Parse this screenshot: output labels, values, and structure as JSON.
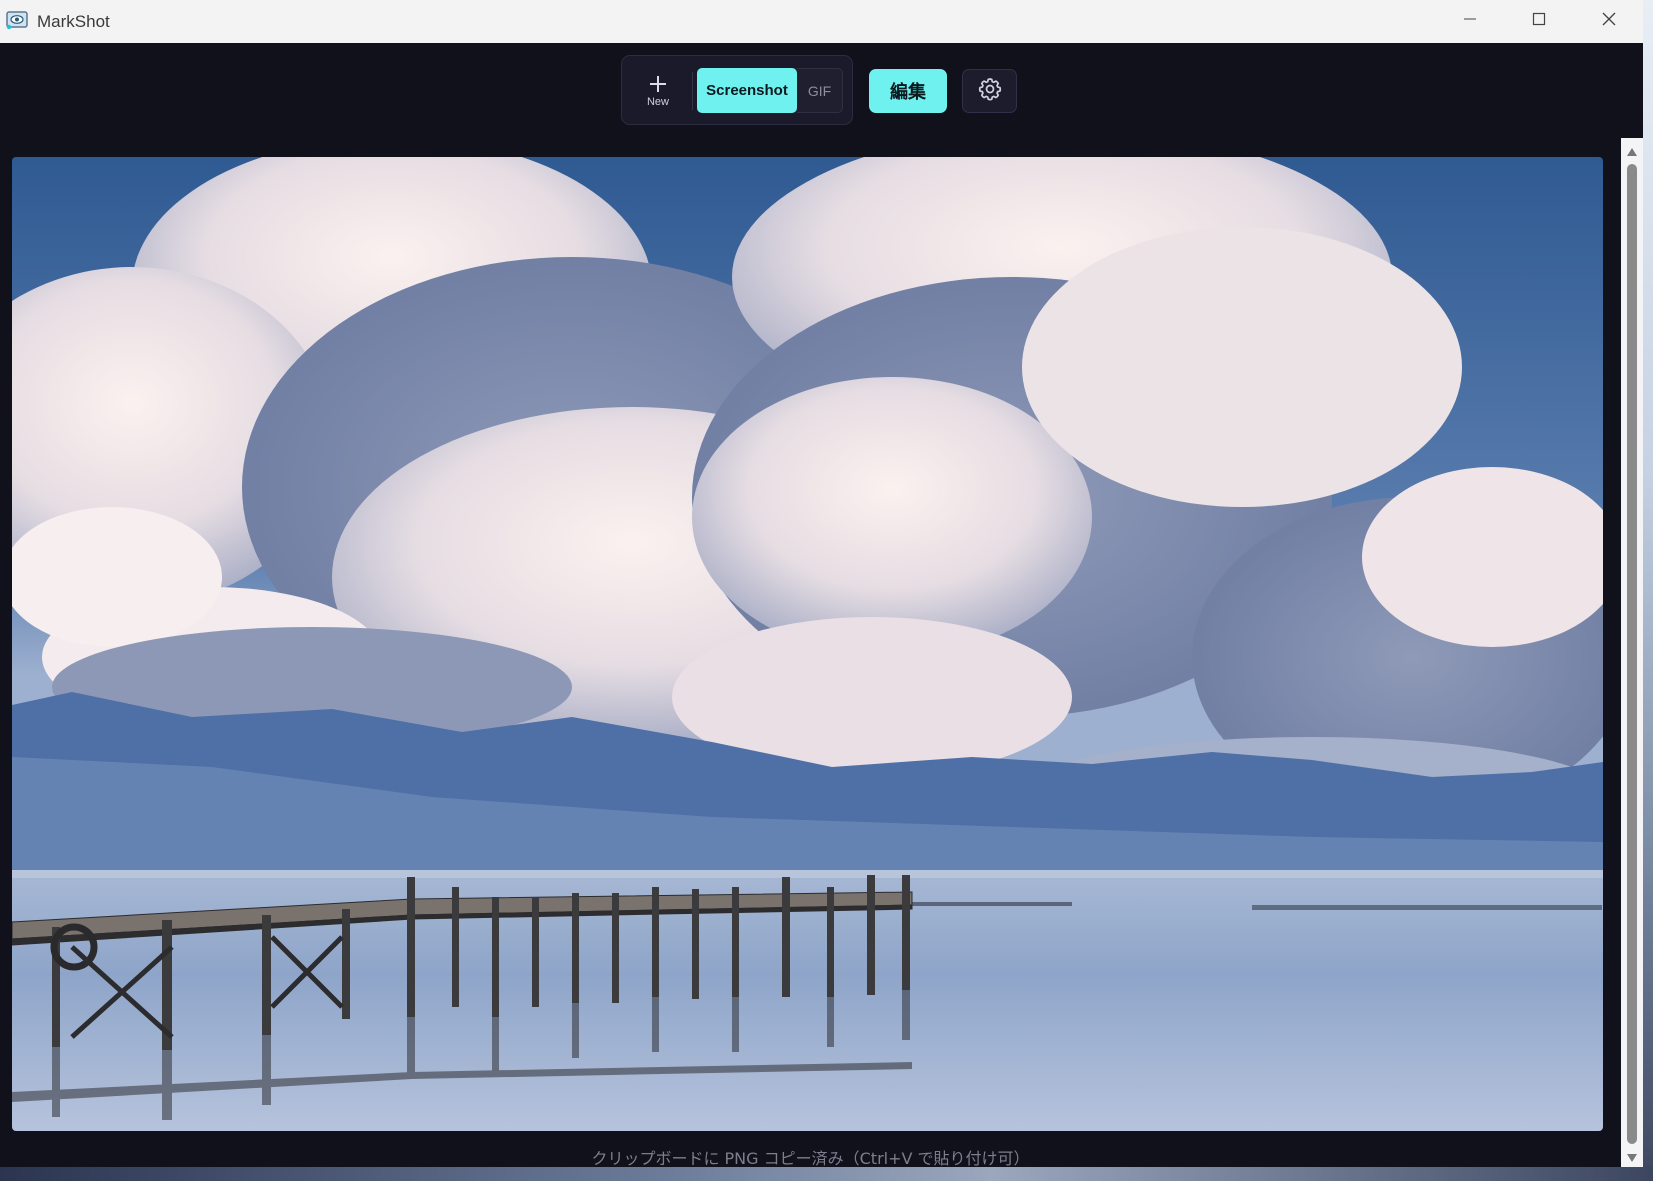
{
  "window": {
    "title": "MarkShot"
  },
  "toolbar": {
    "new_label": "New",
    "mode_screenshot": "Screenshot",
    "mode_gif": "GIF",
    "active_mode": "Screenshot",
    "edit_label": "編集"
  },
  "icons": {
    "app": "markshot-eye-icon",
    "new": "plus-icon",
    "settings": "gear-icon",
    "minimize": "minimize-icon",
    "maximize": "maximize-icon",
    "close": "close-icon"
  },
  "colors": {
    "accent": "#6ff2ef",
    "background": "#11111c"
  },
  "preview": {
    "content": "landscape photo"
  },
  "status": {
    "message": "クリップボードに PNG コピー済み（Ctrl+V で貼り付け可）"
  }
}
